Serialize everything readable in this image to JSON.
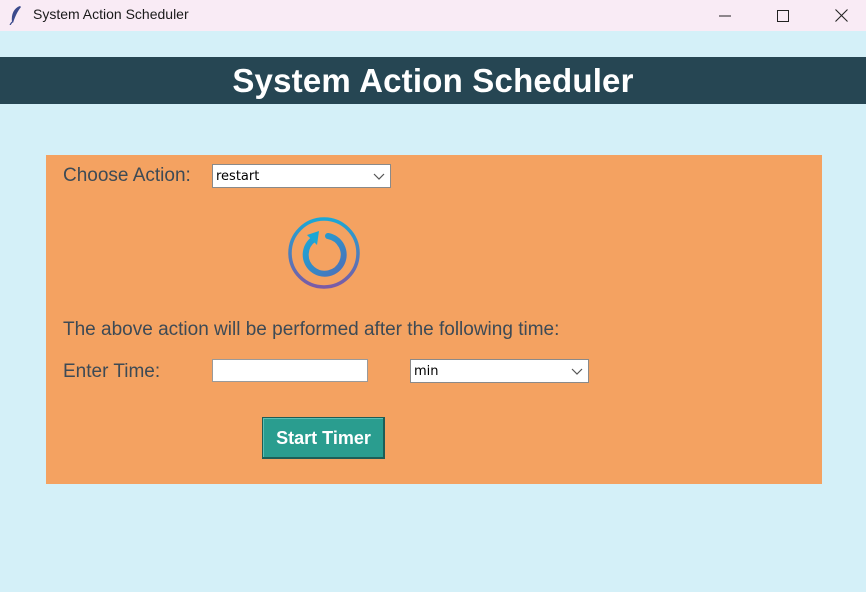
{
  "window": {
    "title": "System Action Scheduler",
    "controls": {
      "minimize_icon": "minimize-icon",
      "maximize_icon": "maximize-icon",
      "close_icon": "close-icon"
    },
    "app_icon": "feather-icon"
  },
  "header": {
    "title": "System Action Scheduler",
    "background": "#264653"
  },
  "panel": {
    "background": "#f4a261",
    "choose_action_label": "Choose Action:",
    "action_select": {
      "value": "restart"
    },
    "action_icon": "restart-icon",
    "info_text": "The above action will be performed after the following time:",
    "enter_time_label": "Enter Time:",
    "time_input": {
      "value": "",
      "placeholder": ""
    },
    "unit_select": {
      "value": "min"
    },
    "start_button": {
      "label": "Start Timer",
      "color": "#2a9d8f"
    }
  },
  "colors": {
    "page_background": "#d4f0f8",
    "titlebar_background": "#f9ebf5"
  }
}
